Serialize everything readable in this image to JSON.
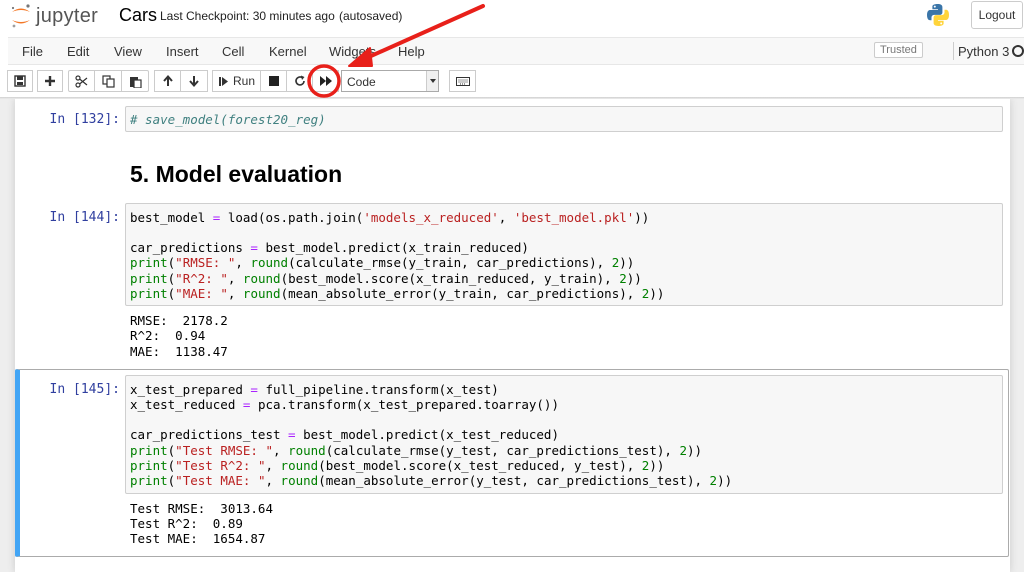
{
  "header": {
    "logo_text": "jupyter",
    "notebook_name": "Cars",
    "checkpoint": "Last Checkpoint: 30 minutes ago",
    "autosave_status": "(autosaved)",
    "logout_label": "Logout"
  },
  "menubar": {
    "items": [
      "File",
      "Edit",
      "View",
      "Insert",
      "Cell",
      "Kernel",
      "Widgets",
      "Help"
    ],
    "trusted_label": "Trusted",
    "kernel_name": "Python 3"
  },
  "toolbar": {
    "run_label": "Run",
    "cell_type": "Code",
    "icons": [
      "save-icon",
      "plus-icon",
      "scissors-icon",
      "copy-icon",
      "paste-icon",
      "arrow-up-icon",
      "arrow-down-icon",
      "step-forward-icon",
      "stop-icon",
      "restart-icon",
      "fast-forward-icon",
      "keyboard-icon"
    ]
  },
  "cells": [
    {
      "prompt": "In [132]:",
      "code": [
        "# save_model(forest20_reg)"
      ]
    },
    {
      "type": "markdown",
      "heading": "5. Model evaluation"
    },
    {
      "prompt": "In [144]:",
      "code": [
        "best_model = load(os.path.join('models_x_reduced', 'best_model.pkl'))",
        "",
        "car_predictions = best_model.predict(x_train_reduced)",
        "print(\"RMSE: \", round(calculate_rmse(y_train, car_predictions), 2))",
        "print(\"R^2: \", round(best_model.score(x_train_reduced, y_train), 2))",
        "print(\"MAE: \", round(mean_absolute_error(y_train, car_predictions), 2))"
      ],
      "output": [
        "RMSE:  2178.2",
        "R^2:  0.94",
        "MAE:  1138.47"
      ]
    },
    {
      "prompt": "In [145]:",
      "code": [
        "x_test_prepared = full_pipeline.transform(x_test)",
        "x_test_reduced = pca.transform(x_test_prepared.toarray())",
        "",
        "car_predictions_test = best_model.predict(x_test_reduced)",
        "print(\"Test RMSE: \", round(calculate_rmse(y_test, car_predictions_test), 2))",
        "print(\"Test R^2: \", round(best_model.score(x_test_reduced, y_test), 2))",
        "print(\"Test MAE: \", round(mean_absolute_error(y_test, car_predictions_test), 2))"
      ],
      "output": [
        "Test RMSE:  3013.64",
        "Test R^2:  0.89",
        "Test MAE:  1654.87"
      ]
    }
  ],
  "annotation": {
    "color": "#e8201a",
    "target": "fast-forward-button"
  },
  "colors": {
    "prompt": "#303f9f",
    "selected_cell_border": "#42a5f5",
    "string": "#ba2121",
    "builtin": "#008000",
    "operator": "#aa22ff",
    "comment": "#408080"
  }
}
